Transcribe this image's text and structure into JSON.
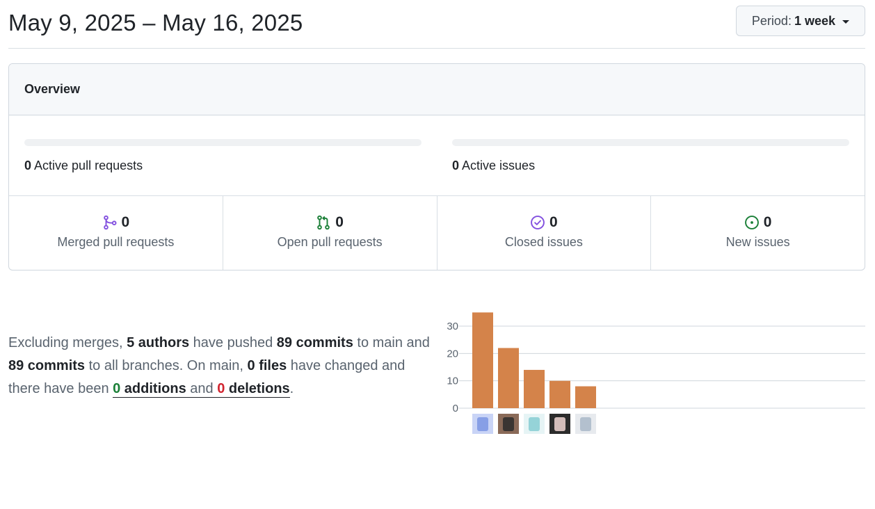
{
  "header": {
    "title": "May 9, 2025 – May 16, 2025",
    "period_label": "Period:",
    "period_value": "1 week"
  },
  "overview": {
    "title": "Overview",
    "active_prs": {
      "count": "0",
      "label": "Active pull requests",
      "fraction": 0
    },
    "active_issues": {
      "count": "0",
      "label": "Active issues",
      "fraction": 0
    },
    "stats": [
      {
        "icon": "git-merge-icon",
        "count": "0",
        "label": "Merged pull requests",
        "color": "#8250df"
      },
      {
        "icon": "git-pull-request-icon",
        "count": "0",
        "label": "Open pull requests",
        "color": "#1a7f37"
      },
      {
        "icon": "issue-closed-icon",
        "count": "0",
        "label": "Closed issues",
        "color": "#8250df"
      },
      {
        "icon": "issue-opened-icon",
        "count": "0",
        "label": "New issues",
        "color": "#1a7f37"
      }
    ]
  },
  "summary": {
    "t1": "Excluding merges, ",
    "authors": "5 authors",
    "t2": " have pushed ",
    "commits_main": "89 commits",
    "t3": " to main and ",
    "commits_all": "89 commits",
    "t4": " to all branches. On main, ",
    "files": "0 files",
    "t5": " have changed and there have been ",
    "additions_num": "0",
    "additions_word": " additions",
    "t6": " and ",
    "deletions_num": "0",
    "deletions_word": " deletions",
    "t7": "."
  },
  "chart_data": {
    "type": "bar",
    "categories": [
      "author-1",
      "author-2",
      "author-3",
      "author-4",
      "author-5"
    ],
    "values": [
      35,
      22,
      14,
      10,
      8
    ],
    "ylim": [
      0,
      30
    ],
    "yticks": [
      0,
      10,
      20,
      30
    ],
    "bar_color": "#d4834a",
    "grid": true
  }
}
